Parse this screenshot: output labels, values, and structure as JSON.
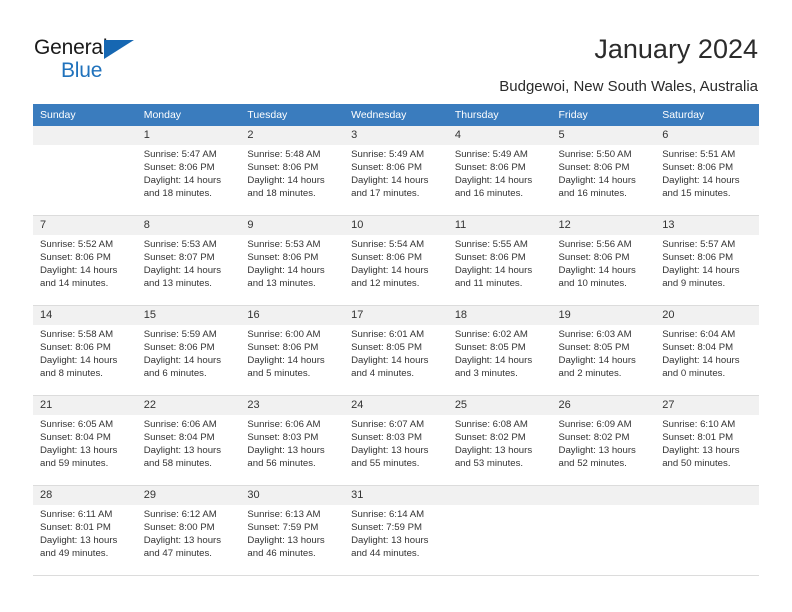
{
  "brand": {
    "name_part1": "General",
    "name_part2": "Blue",
    "triangle_color": "#1667b2",
    "blue_color": "#2072bc"
  },
  "header": {
    "title": "January 2024",
    "subtitle": "Budgewoi, New South Wales, Australia"
  },
  "calendar": {
    "header_bg": "#3a7cbe",
    "daynum_bg": "#f1f1f1",
    "weekday_headers": [
      "Sunday",
      "Monday",
      "Tuesday",
      "Wednesday",
      "Thursday",
      "Friday",
      "Saturday"
    ],
    "weeks": [
      [
        {
          "day": "",
          "sunrise": "",
          "sunset": "",
          "daylight1": "",
          "daylight2": ""
        },
        {
          "day": "1",
          "sunrise": "Sunrise: 5:47 AM",
          "sunset": "Sunset: 8:06 PM",
          "daylight1": "Daylight: 14 hours",
          "daylight2": "and 18 minutes."
        },
        {
          "day": "2",
          "sunrise": "Sunrise: 5:48 AM",
          "sunset": "Sunset: 8:06 PM",
          "daylight1": "Daylight: 14 hours",
          "daylight2": "and 18 minutes."
        },
        {
          "day": "3",
          "sunrise": "Sunrise: 5:49 AM",
          "sunset": "Sunset: 8:06 PM",
          "daylight1": "Daylight: 14 hours",
          "daylight2": "and 17 minutes."
        },
        {
          "day": "4",
          "sunrise": "Sunrise: 5:49 AM",
          "sunset": "Sunset: 8:06 PM",
          "daylight1": "Daylight: 14 hours",
          "daylight2": "and 16 minutes."
        },
        {
          "day": "5",
          "sunrise": "Sunrise: 5:50 AM",
          "sunset": "Sunset: 8:06 PM",
          "daylight1": "Daylight: 14 hours",
          "daylight2": "and 16 minutes."
        },
        {
          "day": "6",
          "sunrise": "Sunrise: 5:51 AM",
          "sunset": "Sunset: 8:06 PM",
          "daylight1": "Daylight: 14 hours",
          "daylight2": "and 15 minutes."
        }
      ],
      [
        {
          "day": "7",
          "sunrise": "Sunrise: 5:52 AM",
          "sunset": "Sunset: 8:06 PM",
          "daylight1": "Daylight: 14 hours",
          "daylight2": "and 14 minutes."
        },
        {
          "day": "8",
          "sunrise": "Sunrise: 5:53 AM",
          "sunset": "Sunset: 8:07 PM",
          "daylight1": "Daylight: 14 hours",
          "daylight2": "and 13 minutes."
        },
        {
          "day": "9",
          "sunrise": "Sunrise: 5:53 AM",
          "sunset": "Sunset: 8:06 PM",
          "daylight1": "Daylight: 14 hours",
          "daylight2": "and 13 minutes."
        },
        {
          "day": "10",
          "sunrise": "Sunrise: 5:54 AM",
          "sunset": "Sunset: 8:06 PM",
          "daylight1": "Daylight: 14 hours",
          "daylight2": "and 12 minutes."
        },
        {
          "day": "11",
          "sunrise": "Sunrise: 5:55 AM",
          "sunset": "Sunset: 8:06 PM",
          "daylight1": "Daylight: 14 hours",
          "daylight2": "and 11 minutes."
        },
        {
          "day": "12",
          "sunrise": "Sunrise: 5:56 AM",
          "sunset": "Sunset: 8:06 PM",
          "daylight1": "Daylight: 14 hours",
          "daylight2": "and 10 minutes."
        },
        {
          "day": "13",
          "sunrise": "Sunrise: 5:57 AM",
          "sunset": "Sunset: 8:06 PM",
          "daylight1": "Daylight: 14 hours",
          "daylight2": "and 9 minutes."
        }
      ],
      [
        {
          "day": "14",
          "sunrise": "Sunrise: 5:58 AM",
          "sunset": "Sunset: 8:06 PM",
          "daylight1": "Daylight: 14 hours",
          "daylight2": "and 8 minutes."
        },
        {
          "day": "15",
          "sunrise": "Sunrise: 5:59 AM",
          "sunset": "Sunset: 8:06 PM",
          "daylight1": "Daylight: 14 hours",
          "daylight2": "and 6 minutes."
        },
        {
          "day": "16",
          "sunrise": "Sunrise: 6:00 AM",
          "sunset": "Sunset: 8:06 PM",
          "daylight1": "Daylight: 14 hours",
          "daylight2": "and 5 minutes."
        },
        {
          "day": "17",
          "sunrise": "Sunrise: 6:01 AM",
          "sunset": "Sunset: 8:05 PM",
          "daylight1": "Daylight: 14 hours",
          "daylight2": "and 4 minutes."
        },
        {
          "day": "18",
          "sunrise": "Sunrise: 6:02 AM",
          "sunset": "Sunset: 8:05 PM",
          "daylight1": "Daylight: 14 hours",
          "daylight2": "and 3 minutes."
        },
        {
          "day": "19",
          "sunrise": "Sunrise: 6:03 AM",
          "sunset": "Sunset: 8:05 PM",
          "daylight1": "Daylight: 14 hours",
          "daylight2": "and 2 minutes."
        },
        {
          "day": "20",
          "sunrise": "Sunrise: 6:04 AM",
          "sunset": "Sunset: 8:04 PM",
          "daylight1": "Daylight: 14 hours",
          "daylight2": "and 0 minutes."
        }
      ],
      [
        {
          "day": "21",
          "sunrise": "Sunrise: 6:05 AM",
          "sunset": "Sunset: 8:04 PM",
          "daylight1": "Daylight: 13 hours",
          "daylight2": "and 59 minutes."
        },
        {
          "day": "22",
          "sunrise": "Sunrise: 6:06 AM",
          "sunset": "Sunset: 8:04 PM",
          "daylight1": "Daylight: 13 hours",
          "daylight2": "and 58 minutes."
        },
        {
          "day": "23",
          "sunrise": "Sunrise: 6:06 AM",
          "sunset": "Sunset: 8:03 PM",
          "daylight1": "Daylight: 13 hours",
          "daylight2": "and 56 minutes."
        },
        {
          "day": "24",
          "sunrise": "Sunrise: 6:07 AM",
          "sunset": "Sunset: 8:03 PM",
          "daylight1": "Daylight: 13 hours",
          "daylight2": "and 55 minutes."
        },
        {
          "day": "25",
          "sunrise": "Sunrise: 6:08 AM",
          "sunset": "Sunset: 8:02 PM",
          "daylight1": "Daylight: 13 hours",
          "daylight2": "and 53 minutes."
        },
        {
          "day": "26",
          "sunrise": "Sunrise: 6:09 AM",
          "sunset": "Sunset: 8:02 PM",
          "daylight1": "Daylight: 13 hours",
          "daylight2": "and 52 minutes."
        },
        {
          "day": "27",
          "sunrise": "Sunrise: 6:10 AM",
          "sunset": "Sunset: 8:01 PM",
          "daylight1": "Daylight: 13 hours",
          "daylight2": "and 50 minutes."
        }
      ],
      [
        {
          "day": "28",
          "sunrise": "Sunrise: 6:11 AM",
          "sunset": "Sunset: 8:01 PM",
          "daylight1": "Daylight: 13 hours",
          "daylight2": "and 49 minutes."
        },
        {
          "day": "29",
          "sunrise": "Sunrise: 6:12 AM",
          "sunset": "Sunset: 8:00 PM",
          "daylight1": "Daylight: 13 hours",
          "daylight2": "and 47 minutes."
        },
        {
          "day": "30",
          "sunrise": "Sunrise: 6:13 AM",
          "sunset": "Sunset: 7:59 PM",
          "daylight1": "Daylight: 13 hours",
          "daylight2": "and 46 minutes."
        },
        {
          "day": "31",
          "sunrise": "Sunrise: 6:14 AM",
          "sunset": "Sunset: 7:59 PM",
          "daylight1": "Daylight: 13 hours",
          "daylight2": "and 44 minutes."
        },
        {
          "day": "",
          "sunrise": "",
          "sunset": "",
          "daylight1": "",
          "daylight2": ""
        },
        {
          "day": "",
          "sunrise": "",
          "sunset": "",
          "daylight1": "",
          "daylight2": ""
        },
        {
          "day": "",
          "sunrise": "",
          "sunset": "",
          "daylight1": "",
          "daylight2": ""
        }
      ]
    ]
  }
}
